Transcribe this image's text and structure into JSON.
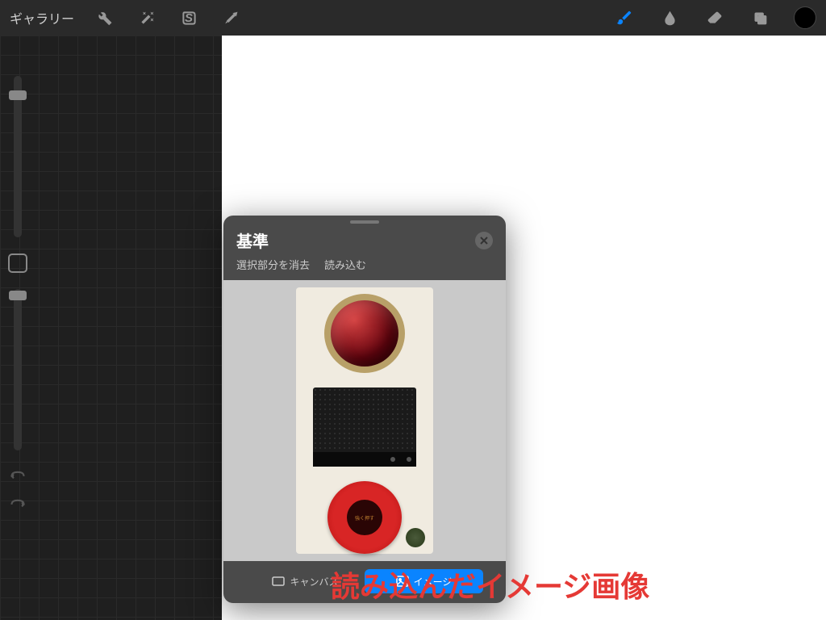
{
  "toolbar": {
    "gallery_label": "ギャラリー"
  },
  "reference_panel": {
    "title": "基準",
    "action_clear": "選択部分を消去",
    "action_load": "読み込む",
    "tab_canvas": "キャンバス",
    "tab_image": "イメージ"
  },
  "caption": "読み込んだイメージ画像",
  "colors": {
    "accent": "#0a84ff",
    "caption": "#e53935"
  }
}
